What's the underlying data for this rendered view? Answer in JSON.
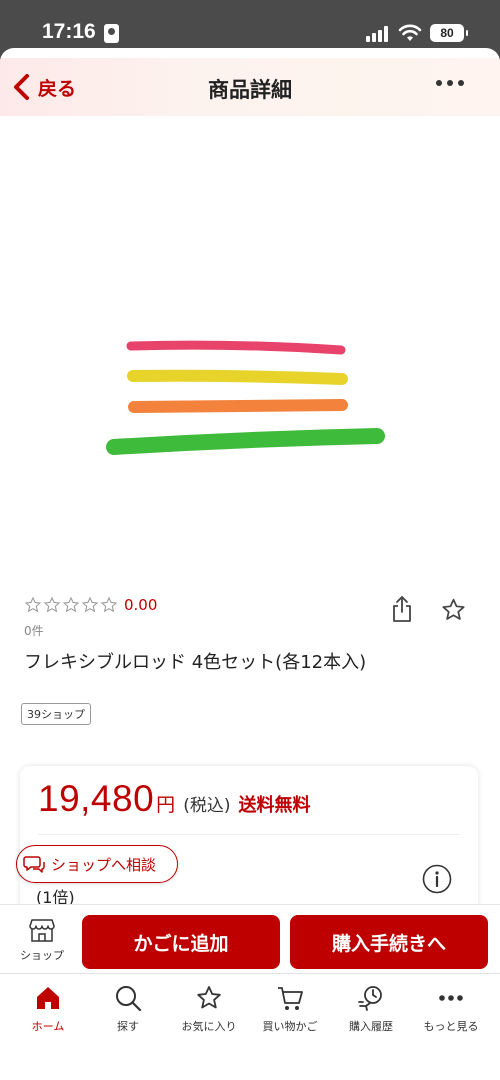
{
  "status_bar": {
    "time": "17:16",
    "battery": "80"
  },
  "nav": {
    "back_label": "戻る",
    "title": "商品詳細"
  },
  "product": {
    "rating_value": "0.00",
    "review_count": "0件",
    "name": "フレキシブルロッド 4色セット(各12本入)",
    "shop_tag": "39ショップ",
    "image_colors": [
      "#e8436a",
      "#e8d32a",
      "#f2823c",
      "#3fbb3c"
    ]
  },
  "price": {
    "amount": "19,480",
    "yen": "円",
    "tax": "(税込)",
    "shipping": "送料無料",
    "multiplier": "(1倍)"
  },
  "consult": {
    "label": "ショップへ相談"
  },
  "actions": {
    "shop_label": "ショップ",
    "add_to_cart": "かごに追加",
    "checkout": "購入手続きへ"
  },
  "tabs": [
    {
      "label": "ホーム",
      "icon": "home-icon",
      "active": true
    },
    {
      "label": "探す",
      "icon": "search-icon"
    },
    {
      "label": "お気に入り",
      "icon": "star-icon"
    },
    {
      "label": "買い物かご",
      "icon": "cart-icon"
    },
    {
      "label": "購入履歴",
      "icon": "history-icon"
    },
    {
      "label": "もっと見る",
      "icon": "more-icon"
    }
  ],
  "colors": {
    "accent": "#bf0000"
  }
}
